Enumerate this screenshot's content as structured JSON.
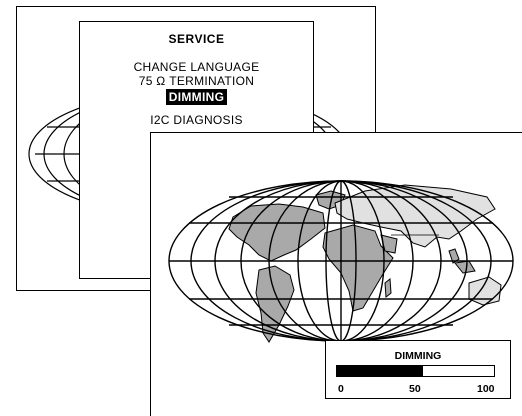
{
  "back_screen": {
    "menu": {
      "title": "SERVICE",
      "items": [
        {
          "label": "CHANGE LANGUAGE",
          "selected": false
        },
        {
          "label": "75 Ω TERMINATION",
          "selected": false
        },
        {
          "label": "DIMMING",
          "selected": true
        },
        {
          "label": "I2C DIAGNOSIS",
          "selected": false
        }
      ]
    }
  },
  "front_screen": {
    "dimming": {
      "title": "DIMMING",
      "value_percent": 55,
      "scale_labels": [
        "0",
        "50",
        "100"
      ]
    }
  }
}
